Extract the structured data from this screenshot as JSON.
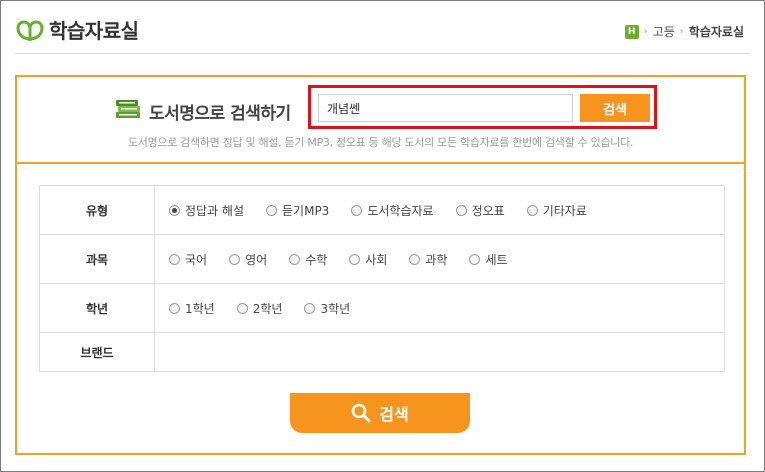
{
  "header": {
    "logo_text": "학습자료실",
    "breadcrumb": {
      "home_label": "H",
      "level1": "고등",
      "current": "학습자료실"
    }
  },
  "search": {
    "title": "도서명으로 검색하기",
    "input_value": "개념쎈",
    "button_label": "검색",
    "description": "도서명으로 검색하면 정답 및 해설, 듣기 MP3, 정오표 등 해당 도서의 모든 학습자료를 한번에 검색할 수 있습니다."
  },
  "filters": [
    {
      "label": "유형",
      "options": [
        {
          "label": "정답과 해설",
          "checked": true
        },
        {
          "label": "듣기MP3",
          "checked": false
        },
        {
          "label": "도서학습자료",
          "checked": false
        },
        {
          "label": "정오표",
          "checked": false
        },
        {
          "label": "기타자료",
          "checked": false
        }
      ]
    },
    {
      "label": "과목",
      "options": [
        {
          "label": "국어",
          "checked": false
        },
        {
          "label": "영어",
          "checked": false
        },
        {
          "label": "수학",
          "checked": false
        },
        {
          "label": "사회",
          "checked": false
        },
        {
          "label": "과학",
          "checked": false
        },
        {
          "label": "세트",
          "checked": false
        }
      ]
    },
    {
      "label": "학년",
      "options": [
        {
          "label": "1학년",
          "checked": false
        },
        {
          "label": "2학년",
          "checked": false
        },
        {
          "label": "3학년",
          "checked": false
        }
      ]
    },
    {
      "label": "브랜드",
      "options": []
    }
  ],
  "main_search_label": "검색",
  "colors": {
    "accent": "#f7941d",
    "border": "#f0a12a",
    "highlight": "#d9141b",
    "brand_green": "#6aae2d"
  }
}
